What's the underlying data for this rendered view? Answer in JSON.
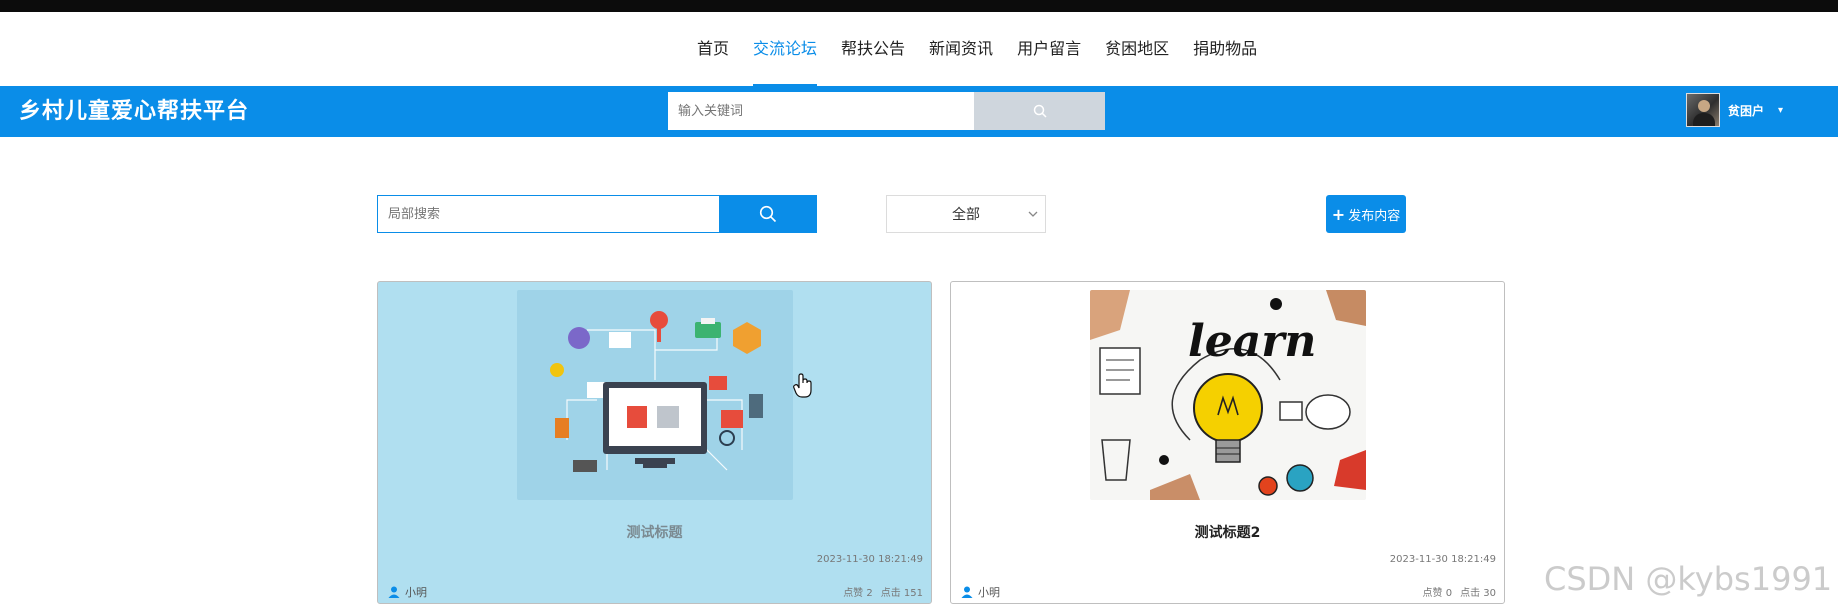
{
  "nav": {
    "items": [
      {
        "label": "首页",
        "active": false
      },
      {
        "label": "交流论坛",
        "active": true
      },
      {
        "label": "帮扶公告",
        "active": false
      },
      {
        "label": "新闻资讯",
        "active": false
      },
      {
        "label": "用户留言",
        "active": false
      },
      {
        "label": "贫困地区",
        "active": false
      },
      {
        "label": "捐助物品",
        "active": false
      }
    ]
  },
  "header": {
    "site_title": "乡村儿童爱心帮扶平台",
    "search_placeholder": "输入关键词",
    "user_name": "贫困户"
  },
  "toolbar": {
    "local_search_placeholder": "局部搜索",
    "category_selected": "全部",
    "publish_label": "发布内容"
  },
  "cards": [
    {
      "title": "测试标题",
      "time": "2023-11-30 18:21:49",
      "author": "小明",
      "likes_text": "点赞 2",
      "clicks_text": "点击 151",
      "hovered": true
    },
    {
      "title": "测试标题2",
      "time": "2023-11-30 18:21:49",
      "author": "小明",
      "likes_text": "点赞 0",
      "clicks_text": "点击 30",
      "hovered": false
    }
  ],
  "watermark": "CSDN @kybs1991",
  "colors": {
    "accent": "#0a8de8",
    "card_hover": "#b0dff0",
    "header_search_button": "#cfd6dd"
  },
  "icons": {
    "search": "search-icon",
    "user": "user-icon",
    "plus": "plus-icon",
    "caret": "chevron-down-icon"
  }
}
